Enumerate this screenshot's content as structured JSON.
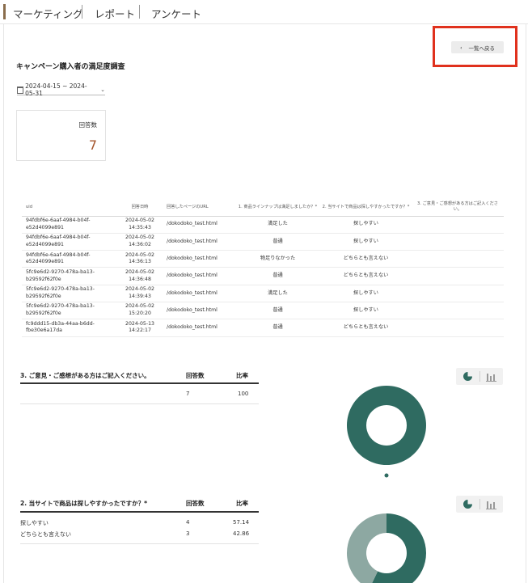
{
  "nav": {
    "tabs": [
      "マーケティング",
      "レポート",
      "アンケート"
    ]
  },
  "back_button": {
    "label": "一覧へ戻る"
  },
  "page_title": "キャンペーン購入者の満足度調査",
  "date_range": "2024-04-15 ~ 2024-05-31",
  "summary": {
    "label": "回答数",
    "value": "7"
  },
  "responses": {
    "headers": [
      "uid",
      "回答日時",
      "回答したページのURL",
      "1. 商品ラインナップは満足しましたか？*",
      "2. 当サイトで商品は探しやすかったですか？*",
      "3. ご意見・ご感想がある方はご記入ください。"
    ],
    "rows": [
      {
        "uid1": "94fdbf6e-6aaf-4984-b04f-",
        "uid2": "e52d4099e891",
        "date": "2024-05-02",
        "time": "14:35:43",
        "url": "/dokodoko_test.html",
        "q1": "満足した",
        "q2": "探しやすい",
        "q3": ""
      },
      {
        "uid1": "94fdbf6e-6aaf-4984-b04f-",
        "uid2": "e52d4099e891",
        "date": "2024-05-02",
        "time": "14:36:02",
        "url": "/dokodoko_test.html",
        "q1": "普通",
        "q2": "探しやすい",
        "q3": ""
      },
      {
        "uid1": "94fdbf6e-6aaf-4984-b04f-",
        "uid2": "e52d4099e891",
        "date": "2024-05-02",
        "time": "14:36:13",
        "url": "/dokodoko_test.html",
        "q1": "物足りなかった",
        "q2": "どちらとも言えない",
        "q3": ""
      },
      {
        "uid1": "5fc9e6d2-9270-478a-ba13-",
        "uid2": "b29592f62f0e",
        "date": "2024-05-02",
        "time": "14:36:48",
        "url": "/dokodoko_test.html",
        "q1": "普通",
        "q2": "どちらとも言えない",
        "q3": ""
      },
      {
        "uid1": "5fc9e6d2-9270-478a-ba13-",
        "uid2": "b29592f62f0e",
        "date": "2024-05-02",
        "time": "14:39:43",
        "url": "/dokodoko_test.html",
        "q1": "満足した",
        "q2": "探しやすい",
        "q3": ""
      },
      {
        "uid1": "5fc9e6d2-9270-478a-ba13-",
        "uid2": "b29592f62f0e",
        "date": "2024-05-02",
        "time": "15:20:20",
        "url": "/dokodoko_test.html",
        "q1": "普通",
        "q2": "探しやすい",
        "q3": ""
      },
      {
        "uid1": "fc9ddd15-db3a-44aa-b6dd-",
        "uid2": "fbe30e6a17da",
        "date": "2024-05-13",
        "time": "14:22:17",
        "url": "/dokodoko_test.html",
        "q1": "普通",
        "q2": "どちらとも言えない",
        "q3": ""
      }
    ]
  },
  "q3": {
    "title": "3. ご意見・ご感想がある方はご記入ください。",
    "col_count": "回答数",
    "col_ratio": "比率",
    "rows": [
      {
        "label": "",
        "count": "7",
        "ratio": "100"
      }
    ]
  },
  "q2": {
    "title": "2. 当サイトで商品は探しやすかったですか？*",
    "col_count": "回答数",
    "col_ratio": "比率",
    "rows": [
      {
        "label": "探しやすい",
        "count": "4",
        "ratio": "57.14"
      },
      {
        "label": "どちらとも言えない",
        "count": "3",
        "ratio": "42.86"
      }
    ]
  },
  "colors": {
    "accent": "#a4542b",
    "chart_primary": "#2f6b61",
    "chart_secondary": "#8da8a2",
    "highlight": "#e0311d"
  },
  "chart_data": [
    {
      "type": "pie",
      "donut": true,
      "categories": [
        ""
      ],
      "values": [
        100
      ]
    },
    {
      "type": "pie",
      "donut": true,
      "categories": [
        "探しやすい",
        "どちらとも言えない"
      ],
      "values": [
        57.14,
        42.86
      ]
    }
  ]
}
